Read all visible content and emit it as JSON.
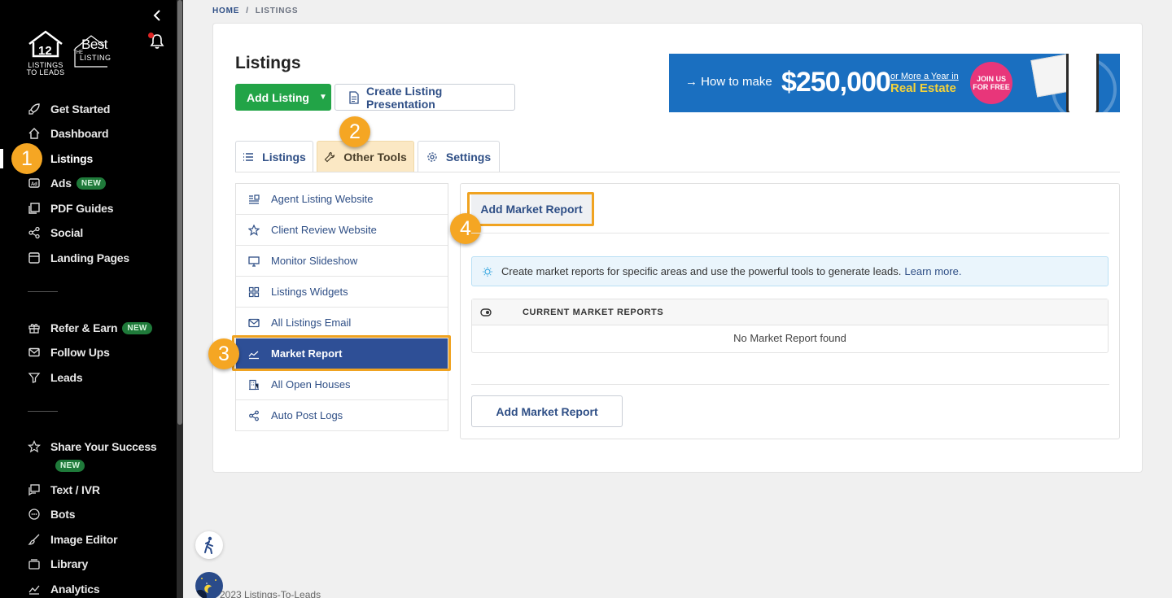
{
  "breadcrumb": {
    "home": "HOME",
    "sep": "/",
    "current": "LISTINGS"
  },
  "logo": {
    "l2l_line1": "LISTINGS",
    "l2l_line2": "TO LEADS",
    "best_the": "THE",
    "best_word": "Best",
    "best_listing": "LISTING"
  },
  "sidebar": {
    "items": [
      {
        "label": "Get Started",
        "icon": "rocket-icon"
      },
      {
        "label": "Dashboard",
        "icon": "home-icon"
      },
      {
        "label": "Listings",
        "icon": "listings-icon"
      },
      {
        "label": "Ads",
        "icon": "ad-icon",
        "badge": "NEW"
      },
      {
        "label": "PDF Guides",
        "icon": "pdf-icon"
      },
      {
        "label": "Social",
        "icon": "share-icon"
      },
      {
        "label": "Landing Pages",
        "icon": "page-icon"
      },
      {
        "label": "Refer & Earn",
        "icon": "gift-icon",
        "badge": "NEW"
      },
      {
        "label": "Follow Ups",
        "icon": "mail-icon"
      },
      {
        "label": "Leads",
        "icon": "filter-icon"
      },
      {
        "label": "Share Your Success",
        "icon": "star-icon",
        "badge": "NEW"
      },
      {
        "label": "Text / IVR",
        "icon": "chat-icon"
      },
      {
        "label": "Bots",
        "icon": "bot-icon"
      },
      {
        "label": "Image Editor",
        "icon": "brush-icon"
      },
      {
        "label": "Library",
        "icon": "folder-icon"
      },
      {
        "label": "Analytics",
        "icon": "chart-icon"
      }
    ]
  },
  "steps": [
    "1",
    "2",
    "3",
    "4"
  ],
  "page": {
    "title": "Listings",
    "add_listing": "Add Listing",
    "create_presentation": "Create Listing Presentation"
  },
  "banner": {
    "how": "How to make",
    "amount": "$250,000",
    "more": "or More a Year in",
    "real_estate": "Real Estate",
    "join1": "JOIN US",
    "join2": "FOR FREE"
  },
  "tabs": [
    {
      "label": "Listings",
      "icon": "list-icon"
    },
    {
      "label": "Other Tools",
      "icon": "wrench-icon"
    },
    {
      "label": "Settings",
      "icon": "gear-icon"
    }
  ],
  "tools_menu": [
    {
      "label": "Agent Listing Website",
      "icon": "website-icon"
    },
    {
      "label": "Client Review Website",
      "icon": "star-icon"
    },
    {
      "label": "Monitor Slideshow",
      "icon": "monitor-icon"
    },
    {
      "label": "Listings Widgets",
      "icon": "widgets-icon"
    },
    {
      "label": "All Listings Email",
      "icon": "mail-icon"
    },
    {
      "label": "Market Report",
      "icon": "chart-icon"
    },
    {
      "label": "All Open Houses",
      "icon": "building-icon"
    },
    {
      "label": "Auto Post Logs",
      "icon": "share-icon"
    }
  ],
  "market": {
    "add_button": "Add Market Report",
    "info_text": "Create market reports for specific areas and use the powerful tools to generate leads.",
    "info_link": "Learn more.",
    "table_header": "CURRENT MARKET REPORTS",
    "empty": "No Market Report found",
    "add_button_bottom": "Add Market Report"
  },
  "footer": "2023 Listings-To-Leads",
  "colors": {
    "accent": "#2f4f86",
    "green": "#22a447",
    "highlight": "#f0a321",
    "active_menu": "#2e4f96"
  }
}
